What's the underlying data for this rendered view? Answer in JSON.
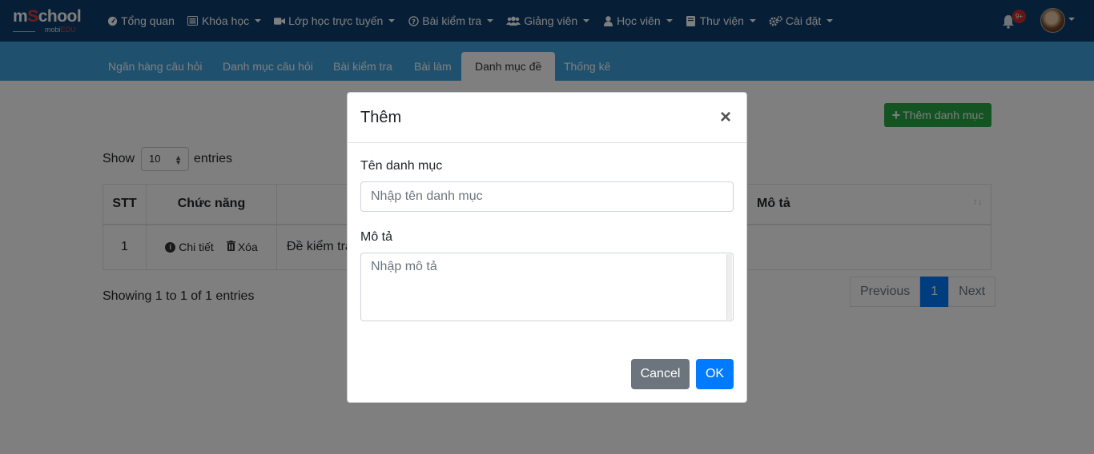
{
  "brand": {
    "name_part1": "m",
    "name_o": "S",
    "name_part2": "chool",
    "sub_part1": "mobi",
    "sub_part2": "EDU"
  },
  "menu": [
    {
      "label": "Tổng quan",
      "icon": "dashboard-icon",
      "caret": false
    },
    {
      "label": "Khóa học",
      "icon": "list-icon",
      "caret": true
    },
    {
      "label": "Lớp học trực tuyến",
      "icon": "video-icon",
      "caret": true
    },
    {
      "label": "Bài kiểm tra",
      "icon": "question-circle-icon",
      "caret": true
    },
    {
      "label": "Giảng viên",
      "icon": "users-icon",
      "caret": true
    },
    {
      "label": "Học viên",
      "icon": "user-icon",
      "caret": true
    },
    {
      "label": "Thư viện",
      "icon": "book-icon",
      "caret": true
    },
    {
      "label": "Cài đặt",
      "icon": "cogs-icon",
      "caret": true
    }
  ],
  "notifications": {
    "badge": "9+"
  },
  "subnav": {
    "tabs": [
      {
        "label": "Ngân hàng câu hỏi",
        "active": false
      },
      {
        "label": "Danh mục câu hỏi",
        "active": false
      },
      {
        "label": "Bài kiểm tra",
        "active": false
      },
      {
        "label": "Bài làm",
        "active": false
      },
      {
        "label": "Danh mục đề",
        "active": true
      },
      {
        "label": "Thống kê",
        "active": false
      }
    ]
  },
  "page": {
    "add_button": "Thêm danh mục",
    "show_label": "Show",
    "entries_value": "10",
    "entries_label": "entries",
    "table": {
      "headers": [
        "STT",
        "Chức năng",
        "",
        "Mô tả"
      ],
      "rows": [
        {
          "stt": "1",
          "detail": "Chi tiết",
          "delete": "Xóa",
          "name": "Đề kiểm tra",
          "description": ""
        }
      ]
    },
    "showing": "Showing 1 to 1 of 1 entries",
    "pager": {
      "previous": "Previous",
      "current": "1",
      "next": "Next"
    }
  },
  "modal": {
    "title": "Thêm",
    "close": "×",
    "name_label": "Tên danh mục",
    "name_placeholder": "Nhập tên danh mục",
    "desc_label": "Mô tả",
    "desc_placeholder": "Nhập mô tả",
    "cancel": "Cancel",
    "ok": "OK"
  },
  "colors": {
    "navbar": "#0d3f6e",
    "subnav": "#3fa2dd",
    "success": "#28a745",
    "primary": "#007bff",
    "secondary": "#6c757d",
    "badge": "#c9302c"
  }
}
